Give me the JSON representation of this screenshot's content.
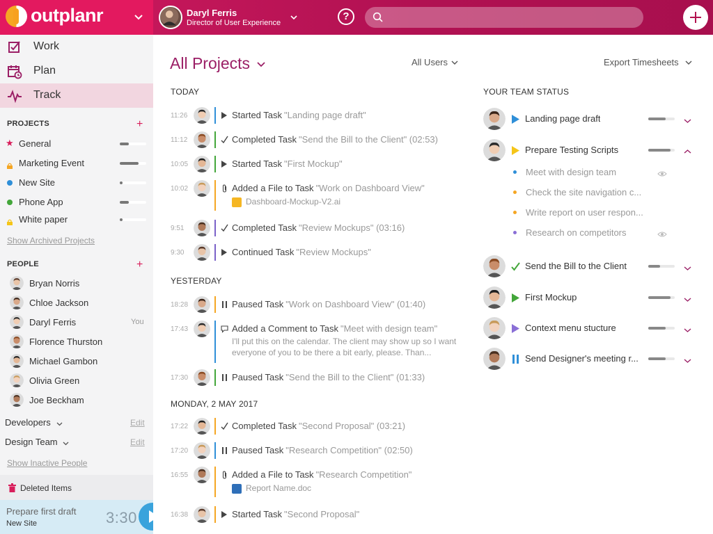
{
  "app": {
    "logo": "outplanr"
  },
  "header": {
    "user_name": "Daryl Ferris",
    "user_role": "Director of User Experience",
    "help": "?",
    "search_placeholder": ""
  },
  "nav": [
    {
      "label": "Work",
      "icon": "work-icon"
    },
    {
      "label": "Plan",
      "icon": "calendar-icon"
    },
    {
      "label": "Track",
      "icon": "pulse-icon"
    }
  ],
  "projects": {
    "heading": "PROJECTS",
    "items": [
      {
        "label": "General",
        "color": "#d81e5b",
        "shape": "star",
        "progress": 0.35
      },
      {
        "label": "Marketing Event",
        "color": "#f5a623",
        "shape": "lock",
        "progress": 0.7
      },
      {
        "label": "New Site",
        "color": "#2f8fd8",
        "shape": "dot",
        "progress": 0.1
      },
      {
        "label": "Phone App",
        "color": "#43a63a",
        "shape": "dot",
        "progress": 0.35
      },
      {
        "label": "White paper",
        "color": "#f5c518",
        "shape": "lock",
        "progress": 0.1
      }
    ],
    "archived_link": "Show Archived Projects"
  },
  "people": {
    "heading": "PEOPLE",
    "items": [
      {
        "name": "Bryan Norris",
        "you": ""
      },
      {
        "name": "Chloe Jackson",
        "you": ""
      },
      {
        "name": "Daryl Ferris",
        "you": "You"
      },
      {
        "name": "Florence Thurston",
        "you": ""
      },
      {
        "name": "Michael Gambon",
        "you": ""
      },
      {
        "name": "Olivia Green",
        "you": ""
      },
      {
        "name": "Joe Beckham",
        "you": ""
      }
    ],
    "groups": [
      {
        "label": "Developers",
        "edit": "Edit"
      },
      {
        "label": "Design Team",
        "edit": "Edit"
      }
    ],
    "inactive_link": "Show Inactive People"
  },
  "deleted_label": "Deleted Items",
  "timer": {
    "task": "Prepare first draft",
    "project": "New Site",
    "time": "3:30"
  },
  "main": {
    "title": "All Projects",
    "filter_users": "All Users",
    "filter_export": "Export Timesheets",
    "days": [
      {
        "label": "TODAY"
      },
      {
        "label": "YESTERDAY"
      },
      {
        "label": "MONDAY, 2 MAY 2017"
      }
    ],
    "activities": [
      {
        "time": "11:26",
        "verb": "Started Task",
        "obj": "\"Landing page draft\"",
        "icon": "play",
        "line": "#2f8fd8"
      },
      {
        "time": "11:12",
        "verb": "Completed Task",
        "obj": "\"Send the Bill to the Client\" (02:53)",
        "icon": "check",
        "line": "#43a63a"
      },
      {
        "time": "10:05",
        "verb": "Started Task",
        "obj": "\"First Mockup\"",
        "icon": "play",
        "line": "#43a63a"
      },
      {
        "time": "10:02",
        "verb": "Added a File to Task",
        "obj": "\"Work on Dashboard View\"",
        "icon": "clip",
        "line": "#f5a623",
        "file": "Dashboard-Mockup-V2.ai",
        "file_color": "#f5b623"
      },
      {
        "time": "9:51",
        "verb": "Completed Task",
        "obj": "\"Review Mockups\" (03:16)",
        "icon": "check",
        "line": "#7b61c8"
      },
      {
        "time": "9:30",
        "verb": "Continued Task",
        "obj": "\"Review Mockups\"",
        "icon": "play",
        "line": "#7b61c8"
      },
      {
        "time": "18:28",
        "verb": "Paused Task",
        "obj": "\"Work on Dashboard View\" (01:40)",
        "icon": "pause",
        "line": "#f5a623"
      },
      {
        "time": "17:43",
        "verb": "Added a Comment to Task",
        "obj": "\"Meet with design team\"",
        "icon": "comment",
        "line": "#2f8fd8",
        "comment": "I'll put this on the calendar. The client may show up so I want everyone of you to be there a bit early, please. Than..."
      },
      {
        "time": "17:30",
        "verb": "Paused Task",
        "obj": "\"Send the Bill to the Client\" (01:33)",
        "icon": "pause",
        "line": "#43a63a"
      },
      {
        "time": "17:22",
        "verb": "Completed Task",
        "obj": "\"Second Proposal\" (03:21)",
        "icon": "check",
        "line": "#f5a623"
      },
      {
        "time": "17:20",
        "verb": "Paused Task",
        "obj": "\"Research Competition\" (02:50)",
        "icon": "pause",
        "line": "#2f8fd8"
      },
      {
        "time": "16:55",
        "verb": "Added a File to Task",
        "obj": "\"Research Competition\"",
        "icon": "clip",
        "line": "#f5a623",
        "file": "Report Name.doc",
        "file_color": "#2f6fb8"
      },
      {
        "time": "16:38",
        "verb": "Started Task",
        "obj": "\"Second Proposal\"",
        "icon": "play",
        "line": "#f5a623"
      }
    ]
  },
  "team": {
    "heading": "YOUR TEAM STATUS",
    "rows": [
      {
        "label": "Landing page draft",
        "icon": "play",
        "icon_color": "#2f8fd8",
        "progress": 0.65,
        "expanded": false
      },
      {
        "label": "Prepare Testing Scripts",
        "icon": "play",
        "icon_color": "#f5c518",
        "progress": 0.85,
        "expanded": true
      },
      {
        "label": "Send the Bill to the Client",
        "icon": "check",
        "icon_color": "#43a63a",
        "progress": 0.45,
        "expanded": false
      },
      {
        "label": "First Mockup",
        "icon": "play",
        "icon_color": "#43a63a",
        "progress": 0.85,
        "expanded": false
      },
      {
        "label": "Context menu stucture",
        "icon": "play",
        "icon_color": "#8a6fd6",
        "progress": 0.65,
        "expanded": false
      },
      {
        "label": "Send Designer's meeting r...",
        "icon": "pause",
        "icon_color": "#2f8fd8",
        "progress": 0.65,
        "expanded": false
      }
    ],
    "subtasks": [
      {
        "label": "Meet with design team",
        "color": "#2f8fd8",
        "eye": true
      },
      {
        "label": "Check the site navigation c...",
        "color": "#f5a623",
        "eye": false
      },
      {
        "label": "Write report on user respon...",
        "color": "#f5a623",
        "eye": false
      },
      {
        "label": "Research on competitors",
        "color": "#8a6fd6",
        "eye": true
      }
    ]
  }
}
